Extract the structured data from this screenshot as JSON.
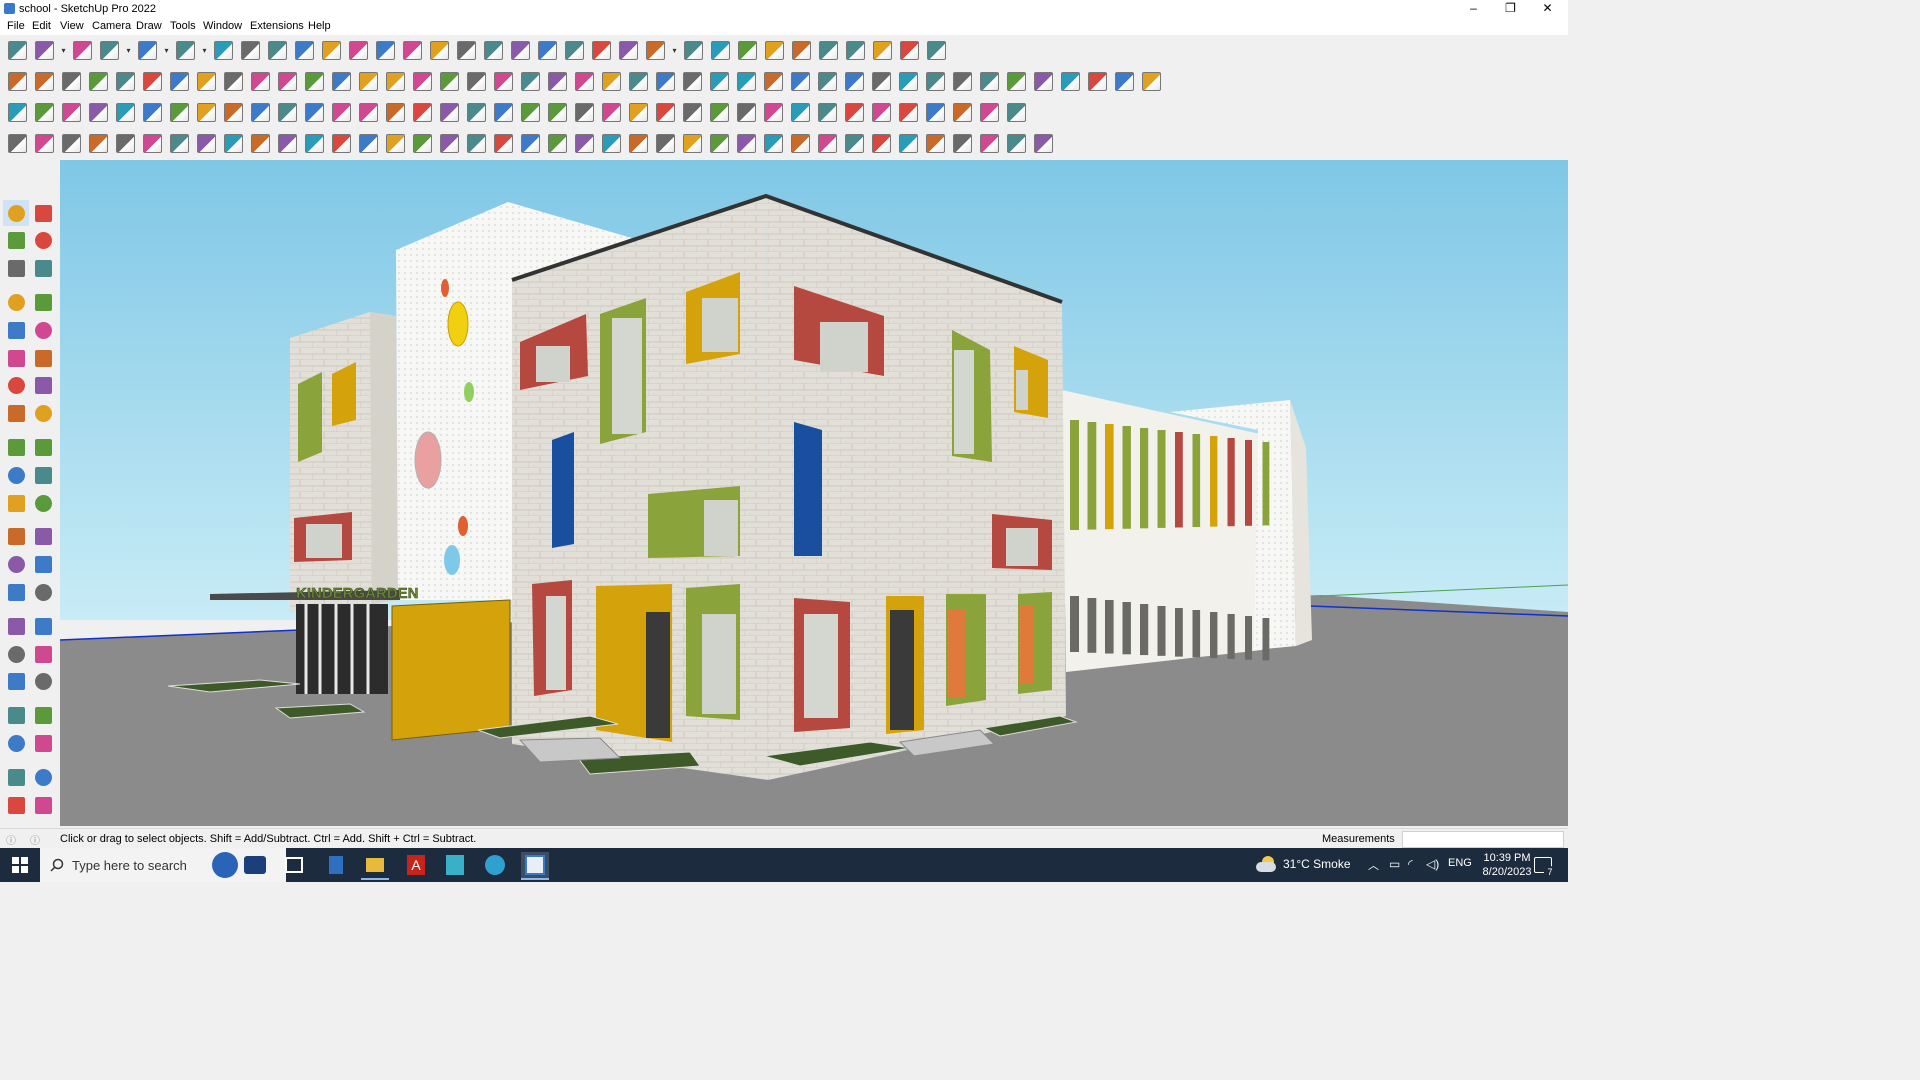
{
  "window": {
    "title": "school - SketchUp Pro 2022",
    "minimize": "–",
    "maximize": "❐",
    "close": "✕"
  },
  "menu": [
    "File",
    "Edit",
    "View",
    "Camera",
    "Draw",
    "Tools",
    "Window",
    "Extensions",
    "Help"
  ],
  "toolbar_rows": [
    [
      "zoom-icon",
      "select-icon",
      "dropdown",
      "eraser-icon",
      "pencil-icon",
      "dropdown",
      "shape-icon",
      "dropdown",
      "rectangle-icon",
      "dropdown",
      "pushpull-icon",
      "followme-icon",
      "move-icon",
      "rotate-icon",
      "scale-icon",
      "tape-icon",
      "text-icon",
      "paint-icon",
      "orbit-icon",
      "pan-icon",
      "zoomwindow-icon",
      "zoomextents-icon",
      "component-icon",
      "sandbox-icon",
      "layers-icon",
      "outliner-icon",
      "styles-icon",
      "dropdown",
      "warehouse-icon",
      "extension-icon",
      "axes-icon",
      "arrows-icon",
      "arrows2-icon",
      "section-icon",
      "iso-icon",
      "undo-icon",
      "redo-icon",
      "print-icon"
    ],
    [
      "solid-icon",
      "solid2-icon",
      "solid3-icon",
      "push-icon",
      "push2-icon",
      "push3-icon",
      "push4-icon",
      "push5-icon",
      "push6-icon",
      "push7-icon",
      "curve-icon",
      "plane-icon",
      "plane2-icon",
      "plane3-icon",
      "box-icon",
      "box2-icon",
      "house-icon",
      "house2-icon",
      "house3-icon",
      "house4-icon",
      "house5-icon",
      "fe-icon",
      "shape2-icon",
      "tool-icon",
      "rect-icon",
      "circle-icon",
      "poly-icon",
      "ellipse-icon",
      "parallel-icon",
      "arc-icon",
      "arc2-icon",
      "star-icon",
      "loop-icon",
      "loop2-icon",
      "line-icon",
      "eraser2-icon",
      "roof-icon",
      "roof2-icon",
      "roof3-icon",
      "roof4-icon",
      "roof5-icon",
      "roof6-icon",
      "roof7-icon"
    ],
    [
      "face-icon",
      "face2-icon",
      "face3-icon",
      "text3d-icon",
      "circle3d-icon",
      "component2-icon",
      "flip-icon",
      "wall-icon",
      "wall2-icon",
      "frame-icon",
      "frame2-icon",
      "beam-icon",
      "rail-icon",
      "node-icon",
      "plus-icon",
      "plus2-icon",
      "cross-icon",
      "cone-icon",
      "cone2-icon",
      "tri-icon",
      "spiral-icon",
      "spiral2-icon",
      "spiral3-icon",
      "star2-icon",
      "box3-icon",
      "loop3-icon",
      "arrow-icon",
      "arrow2-icon",
      "arrow3-icon",
      "gem-icon",
      "gear2-icon",
      "gear3-icon",
      "grid-icon",
      "grid2-icon",
      "grid3-icon",
      "grid4-icon",
      "dots-icon",
      "curve2-icon"
    ],
    [
      "poly2-icon",
      "bezier-icon",
      "paint2-icon",
      "tool3-icon",
      "tool4-icon",
      "tool5-icon",
      "tool6-icon",
      "tool7-icon",
      "tool8-icon",
      "tool9-icon",
      "tool10-icon",
      "tool11-icon",
      "tool12-icon",
      "tool13-icon",
      "tool14-icon",
      "tool15-icon",
      "tool16-icon",
      "tool17-icon",
      "tool18-icon",
      "tool19-icon",
      "tool20-icon",
      "tool21-icon",
      "tool22-icon",
      "tool23-icon",
      "tool24-icon",
      "tool25-icon",
      "tool26-icon",
      "tool27-icon",
      "tool28-icon",
      "tool29-icon",
      "tool30-icon",
      "tool31-icon",
      "tool32-icon",
      "tool33-icon",
      "tool34-icon",
      "tool35-icon",
      "tool36-icon",
      "tool37-icon",
      "tool38-icon"
    ]
  ],
  "left_tools": [
    "select-icon",
    "orbit-icon",
    "paint-bucket-icon",
    "eraser-icon",
    "component-icon",
    "tape-measure-icon",
    "line-icon",
    "freehand-icon",
    "rectangle-icon",
    "rotated-rect-icon",
    "circle-icon",
    "polygon-icon",
    "arc-icon",
    "pie-icon",
    "two-point-arc-icon",
    "three-point-arc-icon",
    "move-icon",
    "pushpull-icon",
    "rotate-icon",
    "followme-icon",
    "scale-icon",
    "offset-icon",
    "tape-icon",
    "dimension-icon",
    "protractor-icon",
    "text-icon",
    "axes-icon",
    "3d-text-icon",
    "orbit2-icon",
    "pan-icon",
    "zoom-icon",
    "zoom-window-icon",
    "zoom-extents-icon",
    "previous-icon",
    "position-camera-icon",
    "look-around-icon",
    "walk-icon",
    "section-plane-icon",
    "sandbox-icon",
    "sandbox2-icon",
    "layers-icon",
    "outliner-icon"
  ],
  "colors": {
    "accent": "#3a78c8",
    "sky": "#a8dcee",
    "ground": "#8c8c8c",
    "wall": "#e4e1da",
    "taskbar": "#1c2b3d",
    "red": "#b5483f",
    "green": "#8aa33a",
    "yellow": "#d4a30c",
    "blue": "#1a4fa0"
  },
  "building": {
    "sign": "KINDERGARDEN"
  },
  "status": {
    "hint": "Click or drag to select objects. Shift = Add/Subtract. Ctrl = Add. Shift + Ctrl = Subtract.",
    "measurements_label": "Measurements",
    "measurements_value": ""
  },
  "taskbar": {
    "search_placeholder": "Type here to search",
    "weather": "31°C  Smoke",
    "lang": "ENG",
    "time": "10:39 PM",
    "date": "8/20/2023",
    "notifications": "7",
    "apps": [
      "task-view-icon",
      "calculator-icon",
      "file-explorer-icon",
      "acrobat-icon",
      "maps-icon",
      "edge-icon",
      "sketchup-icon"
    ]
  }
}
